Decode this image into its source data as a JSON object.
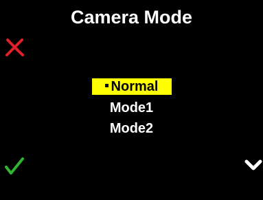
{
  "screen": {
    "title": "Camera Mode"
  },
  "menu": {
    "items": [
      {
        "label": "Normal",
        "selected": true
      },
      {
        "label": "Mode1",
        "selected": false
      },
      {
        "label": "Mode2",
        "selected": false
      }
    ]
  },
  "buttons": {
    "cancel_icon": "red-x-icon",
    "confirm_icon": "green-check-icon",
    "next_icon": "white-chevron-down-icon"
  },
  "colors": {
    "background": "#000000",
    "text": "#ffffff",
    "highlight": "#ffff00",
    "highlight_text": "#000000",
    "cancel": "#e0202a",
    "confirm": "#2fb52f"
  }
}
